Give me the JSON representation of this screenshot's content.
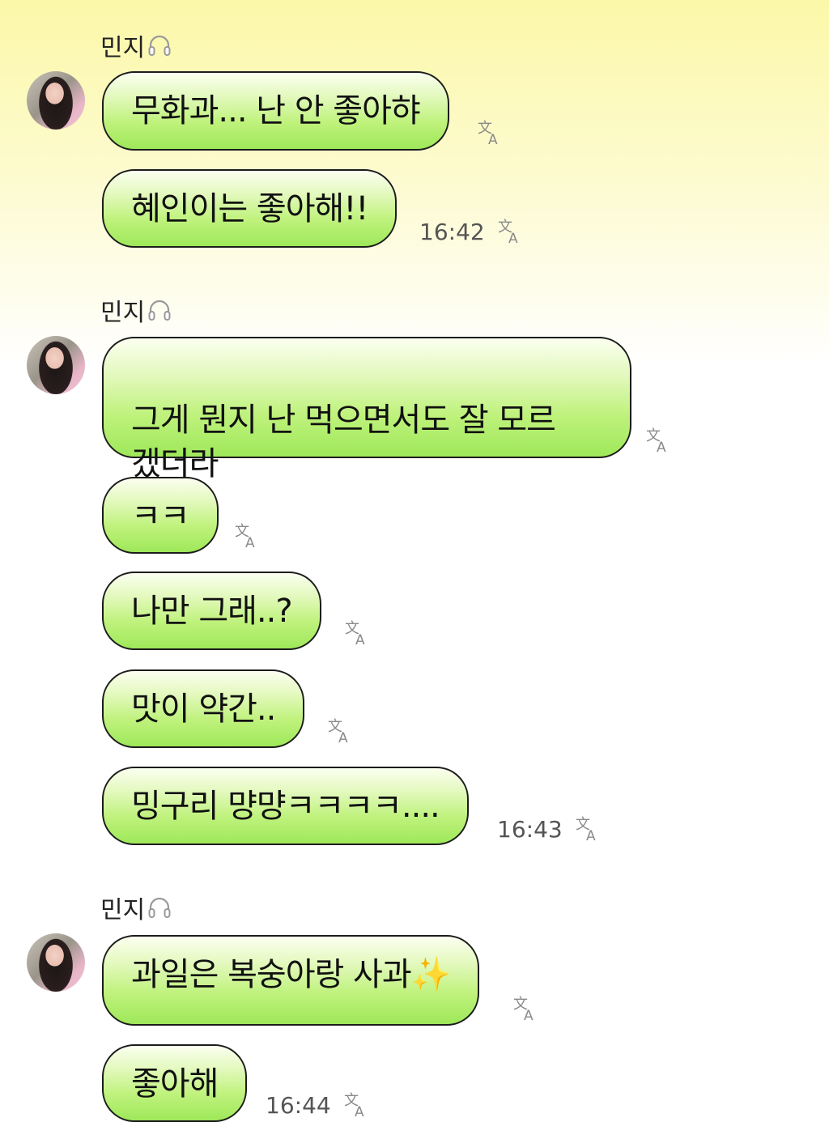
{
  "groups": [
    {
      "sender": "민지",
      "messages": [
        {
          "text": "무화과... 난 안 좋아햐",
          "time": ""
        },
        {
          "text": "혜인이는 좋아해!!",
          "time": "16:42"
        }
      ]
    },
    {
      "sender": "민지",
      "messages": [
        {
          "text": "그게 뭔지 난 먹으면서도 잘 모르\n겠더라",
          "time": ""
        },
        {
          "text": "ㅋㅋ",
          "time": ""
        },
        {
          "text": "나만 그래..?",
          "time": ""
        },
        {
          "text": "맛이 약간..",
          "time": ""
        },
        {
          "text": "밍구리 먕먕ㅋㅋㅋㅋ....",
          "time": "16:43"
        }
      ]
    },
    {
      "sender": "민지",
      "messages": [
        {
          "text": "과일은 복숭아랑 사과✨",
          "time": ""
        },
        {
          "text": "좋아해",
          "time": "16:44"
        }
      ]
    }
  ],
  "icons": {
    "sender_badge": "headphone-icon",
    "translate": "translate-icon"
  },
  "colors": {
    "bubble_top": "#fbfff0",
    "bubble_bottom": "#9fe85a",
    "bubble_border": "#1c1c1c",
    "bg_top": "#fcf8a8"
  }
}
